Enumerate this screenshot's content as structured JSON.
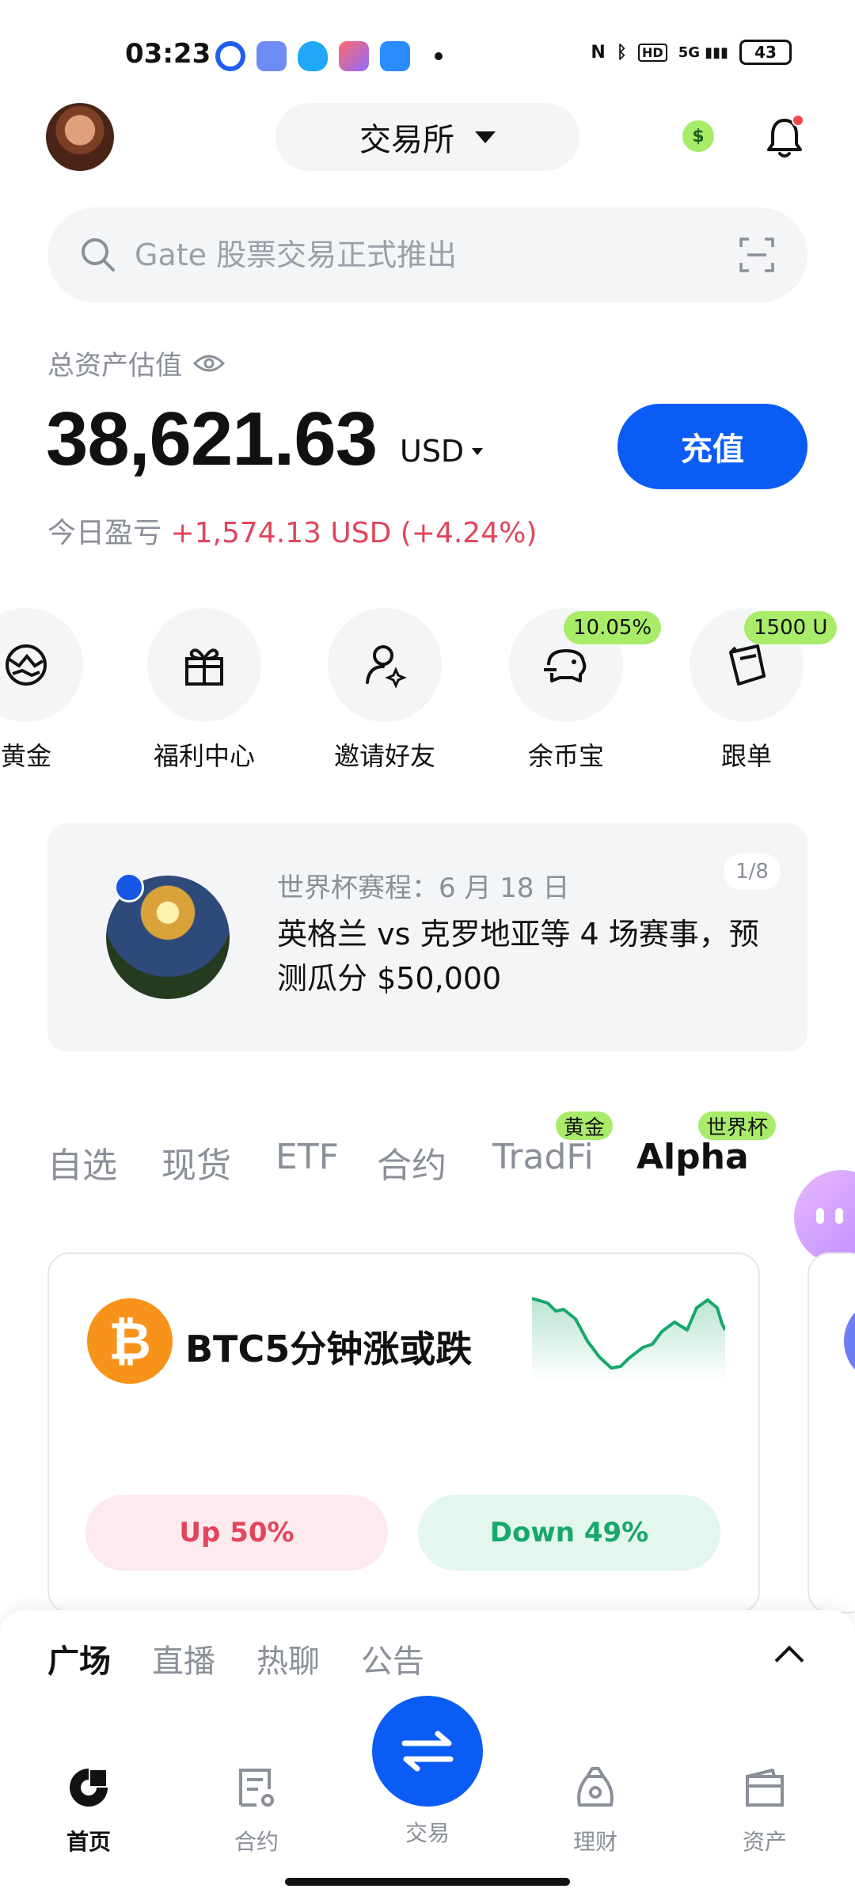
{
  "status_bar": {
    "time": "03:23",
    "battery": "43",
    "network": "5G"
  },
  "header": {
    "exchange_label": "交易所"
  },
  "search": {
    "placeholder": "Gate 股票交易正式推出"
  },
  "assets": {
    "label": "总资产估值",
    "balance": "38,621.63",
    "currency": "USD",
    "pnl_label": "今日盈亏",
    "pnl_value": "+1,574.13 USD (+4.24%)",
    "deposit_label": "充值"
  },
  "quick_menu": [
    {
      "label": "黄金",
      "icon": "gold-globe-icon"
    },
    {
      "label": "福利中心",
      "icon": "gift-icon"
    },
    {
      "label": "邀请好友",
      "icon": "invite-user-icon"
    },
    {
      "label": "余币宝",
      "icon": "piggy-bank-icon",
      "badge": "10.05%"
    },
    {
      "label": "跟单",
      "icon": "copy-trade-icon",
      "badge": "1500 U"
    }
  ],
  "banner": {
    "subtitle": "世界杯赛程：6 月 18 日",
    "title": "英格兰 vs 克罗地亚等 4 场赛事，预测瓜分 $50,000",
    "page": "1/8"
  },
  "market_tabs": [
    {
      "label": "自选"
    },
    {
      "label": "现货"
    },
    {
      "label": "ETF"
    },
    {
      "label": "合约"
    },
    {
      "label": "TradFi",
      "badge": "黄金"
    },
    {
      "label": "Alpha",
      "badge": "世界杯",
      "active": true
    }
  ],
  "prediction_card": {
    "title": "BTC5分钟涨或跌",
    "up_label": "Up 50%",
    "down_label": "Down 49%"
  },
  "sheet_tabs": [
    {
      "label": "广场",
      "active": true
    },
    {
      "label": "直播"
    },
    {
      "label": "热聊"
    },
    {
      "label": "公告"
    }
  ],
  "bottom_nav": [
    {
      "label": "首页",
      "active": true
    },
    {
      "label": "合约"
    },
    {
      "label": "交易"
    },
    {
      "label": "理财"
    },
    {
      "label": "资产"
    }
  ],
  "colors": {
    "accent": "#0a5cf5",
    "up": "#e0465b",
    "down": "#17a86b",
    "badge": "#a9ec6a"
  }
}
